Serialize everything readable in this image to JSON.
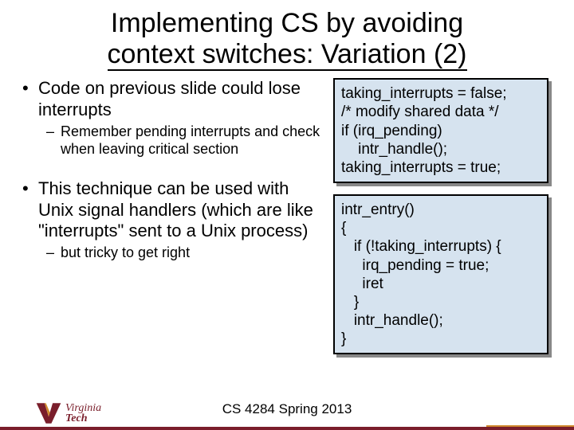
{
  "title_l1": "Implementing CS by avoiding",
  "title_l2": "context switches: Variation (2)",
  "bullets": {
    "b1": "Code on previous slide could lose interrupts",
    "b1a": "Remember pending interrupts and check when leaving critical section",
    "b2": "This technique can be used with Unix signal handlers (which are like \"interrupts\" sent to a Unix process)",
    "b2a": "but tricky to get right"
  },
  "code1": "taking_interrupts = false;\n/* modify shared data */\nif (irq_pending)\n    intr_handle();\ntaking_interrupts = true;",
  "code2": "intr_entry()\n{\n   if (!taking_interrupts) {\n     irq_pending = true;\n     iret\n   }\n   intr_handle();\n}",
  "footer": "CS 4284 Spring 2013",
  "logo": {
    "top": "Virginia",
    "bottom": "Tech"
  }
}
